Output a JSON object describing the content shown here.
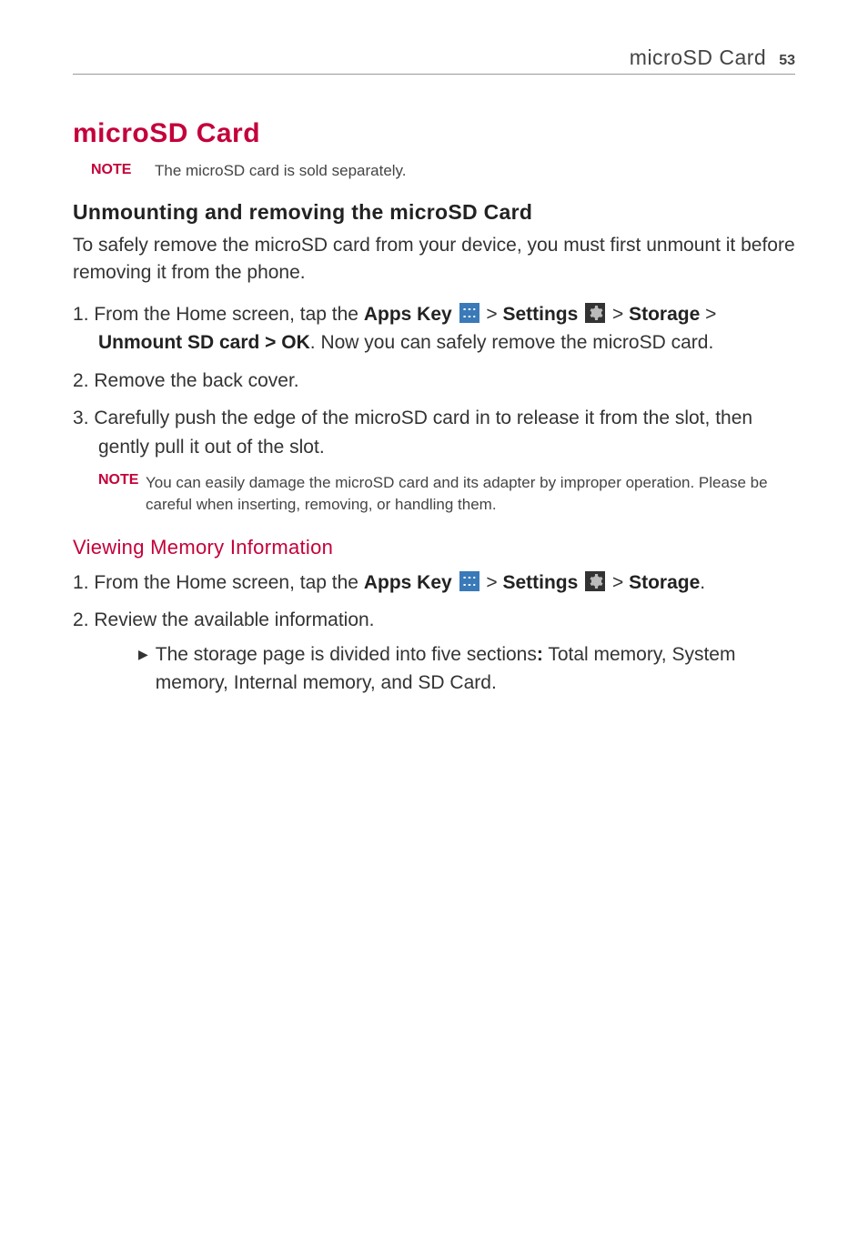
{
  "header": {
    "title": "microSD Card",
    "page_number": "53"
  },
  "main_title": "microSD Card",
  "note1": {
    "label": "NOTE",
    "text": "The microSD card is sold separately."
  },
  "section1": {
    "heading": "Unmounting and removing the microSD Card",
    "intro": "To safely remove the microSD card from your device, you must first unmount it before removing it from the phone.",
    "step1_a": "From the Home screen, tap the ",
    "step1_apps": "Apps Key",
    "step1_b": " > ",
    "step1_settings": "Settings",
    "step1_c": " > ",
    "step1_storage": "Storage",
    "step1_d": " > ",
    "step1_unmount": "Unmount SD card > OK",
    "step1_e": ". Now you can safely remove the microSD card.",
    "step2": "Remove the back cover.",
    "step3": "Carefully push the edge of the microSD card in to release it from the slot, then gently pull it out of the slot."
  },
  "note2": {
    "label": "NOTE",
    "text": "You can easily damage the microSD card and its adapter by improper operation. Please be careful when inserting, removing, or handling them."
  },
  "section2": {
    "heading": "Viewing Memory Information",
    "step1_a": "From the Home screen, tap the ",
    "step1_apps": "Apps Key",
    "step1_b": " > ",
    "step1_settings": "Settings",
    "step1_c": " > ",
    "step1_storage": "Storage",
    "step1_d": ".",
    "step2": "Review the available information.",
    "bullet_a": "The storage page is divided into five sections",
    "bullet_colon": ":",
    "bullet_b": " Total memory, System memory, Internal memory, and SD Card."
  }
}
